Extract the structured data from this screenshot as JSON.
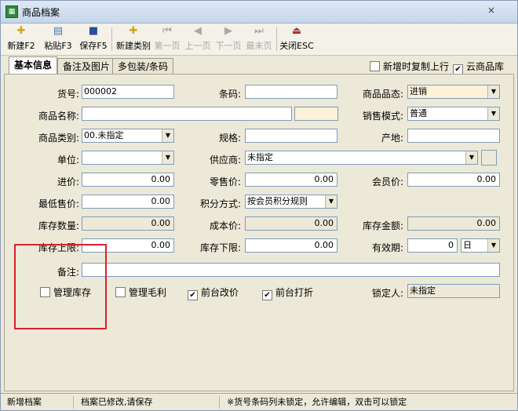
{
  "window": {
    "title": "商品档案",
    "close": "×"
  },
  "toolbar": {
    "items": [
      {
        "label": "新建F2"
      },
      {
        "label": "粘贴F3"
      },
      {
        "label": "保存F5"
      },
      {
        "label": "新建类别"
      },
      {
        "label": "第一页"
      },
      {
        "label": "上一页"
      },
      {
        "label": "下一页"
      },
      {
        "label": "最末页"
      },
      {
        "label": "关闭ESC"
      }
    ]
  },
  "tabs": [
    {
      "label": "基本信息",
      "active": true
    },
    {
      "label": "备注及图片",
      "active": false
    },
    {
      "label": "多包装/条码",
      "active": false
    }
  ],
  "options": {
    "copy_last": {
      "label": "新增时复制上行",
      "checked": false
    },
    "cloud": {
      "label": "云商品库",
      "checked": true
    }
  },
  "form": {
    "item_no": {
      "label": "货号:",
      "value": "000002"
    },
    "barcode": {
      "label": "条码:",
      "value": ""
    },
    "state": {
      "label": "商品品态:",
      "value": "进销"
    },
    "name": {
      "label": "商品名称:",
      "value": ""
    },
    "sale_mode": {
      "label": "销售模式:",
      "value": "普通"
    },
    "category": {
      "label": "商品类别:",
      "value": "00.未指定"
    },
    "spec": {
      "label": "规格:",
      "value": ""
    },
    "origin": {
      "label": "产地:",
      "value": ""
    },
    "unit": {
      "label": "单位:",
      "value": ""
    },
    "supplier": {
      "label": "供应商:",
      "value": "未指定"
    },
    "cost": {
      "label": "进价:",
      "value": "0.00"
    },
    "retail": {
      "label": "零售价:",
      "value": "0.00"
    },
    "member": {
      "label": "会员价:",
      "value": "0.00"
    },
    "min_price": {
      "label": "最低售价:",
      "value": "0.00"
    },
    "points": {
      "label": "积分方式:",
      "value": "按会员积分规则"
    },
    "stock_qty": {
      "label": "库存数量:",
      "value": "0.00"
    },
    "unit_cost": {
      "label": "成本价:",
      "value": "0.00"
    },
    "stock_amt": {
      "label": "库存金额:",
      "value": "0.00"
    },
    "stock_max": {
      "label": "库存上限:",
      "value": "0.00"
    },
    "stock_min": {
      "label": "库存下限:",
      "value": "0.00"
    },
    "shelf_life": {
      "label": "有效期:",
      "value": "0",
      "unit": "日"
    },
    "remark": {
      "label": "备注:",
      "value": ""
    },
    "locker": {
      "label": "锁定人:",
      "value": "未指定"
    }
  },
  "checks": {
    "manage_stock": {
      "label": "管理库存",
      "checked": false
    },
    "manage_margin": {
      "label": "管理毛利",
      "checked": false
    },
    "front_price": {
      "label": "前台改价",
      "checked": true
    },
    "front_discount": {
      "label": "前台打折",
      "checked": true
    }
  },
  "status": {
    "mode": "新增档案",
    "modified": "档案已修改,请保存",
    "hint": "※货号条码列未锁定，允许编辑，双击可以锁定"
  }
}
